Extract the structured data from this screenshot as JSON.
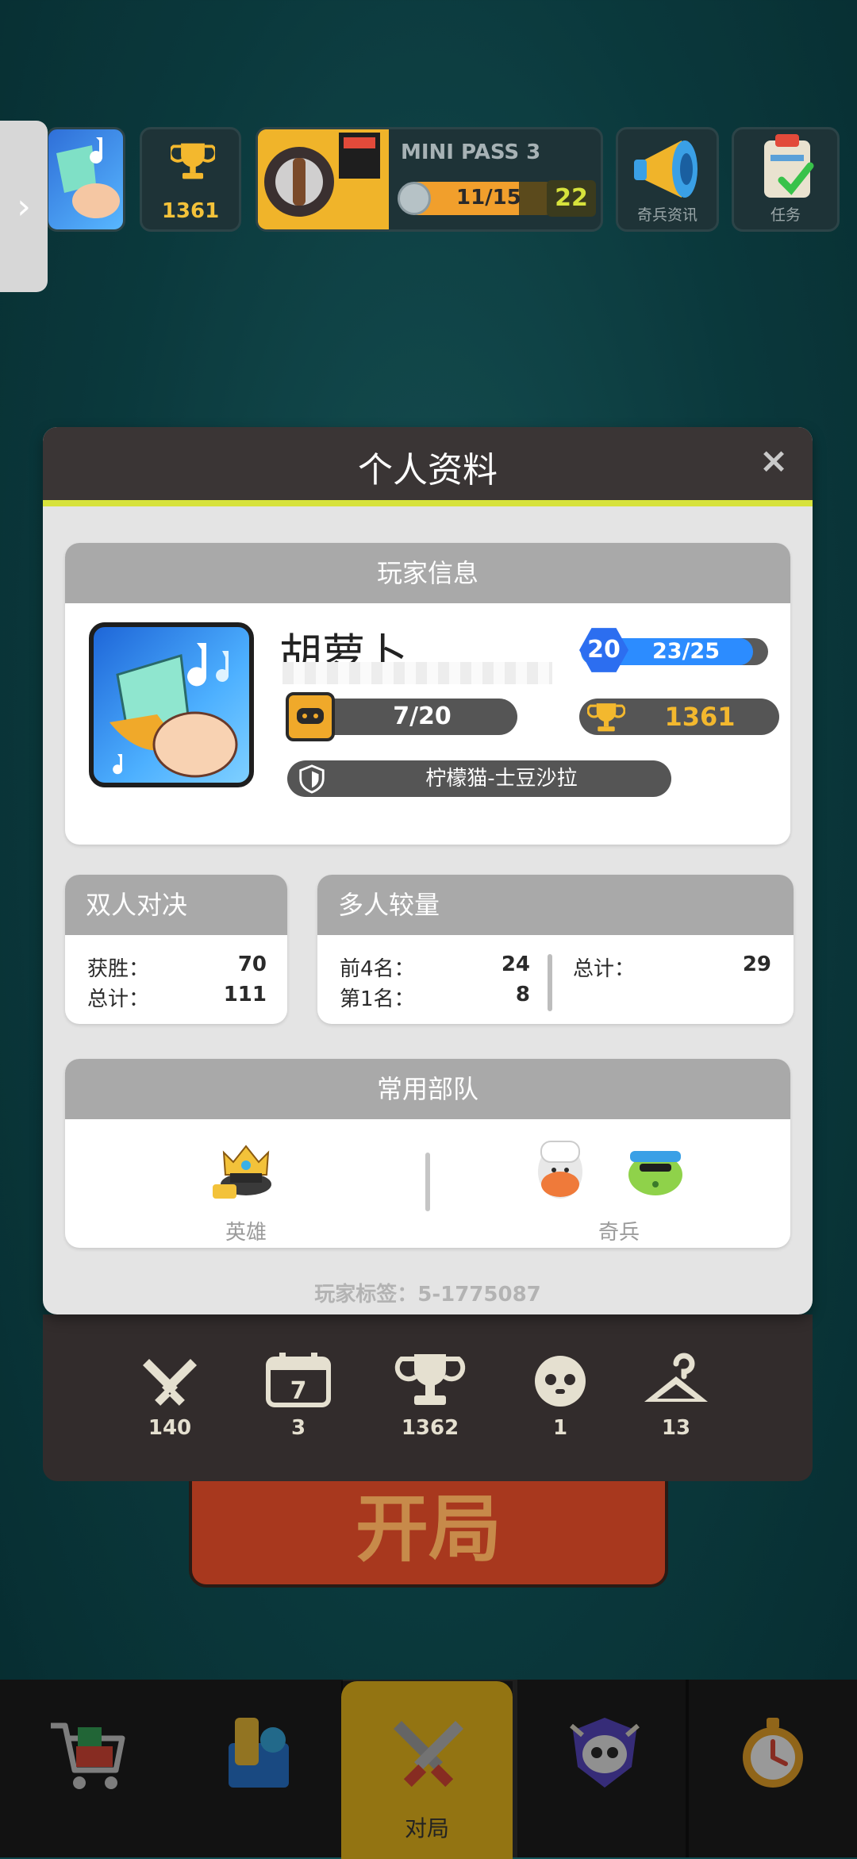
{
  "top_bar": {
    "trophy_count": "1361",
    "pass_title": "MINI PASS 3",
    "pass_progress": "11/15",
    "pass_progress_fraction": 0.733,
    "pass_level": "22",
    "news_label": "奇兵资讯",
    "tasks_label": "任务"
  },
  "modal": {
    "title": "个人资料",
    "close_symbol": "×",
    "player_info": {
      "header": "玩家信息",
      "name": "胡萝卜",
      "level": "20",
      "level_progress": "23/25",
      "level_progress_fraction": 0.92,
      "cards": "7/20",
      "trophies": "1361",
      "club": "柠檬猫-士豆沙拉"
    },
    "duel": {
      "header": "双人对决",
      "wins_label": "获胜：",
      "wins": "70",
      "total_label": "总计：",
      "total": "111"
    },
    "multiplayer": {
      "header": "多人较量",
      "top4_label": "前4名：",
      "top4": "24",
      "first_label": "第1名：",
      "first": "8",
      "total_label": "总计：",
      "total": "29"
    },
    "troops": {
      "header": "常用部队",
      "hero_label": "英雄",
      "troop_label": "奇兵"
    },
    "player_tag": "玩家标签：5-1775087"
  },
  "stats": [
    {
      "icon": "crossed-swords-icon",
      "value": "140"
    },
    {
      "icon": "calendar-icon",
      "value": "3"
    },
    {
      "icon": "trophy-icon",
      "value": "1362"
    },
    {
      "icon": "face-icon",
      "value": "1"
    },
    {
      "icon": "hanger-icon",
      "value": "13"
    }
  ],
  "calendar_day": "7",
  "start_button": "开局",
  "nav": {
    "battle_label": "对局"
  },
  "colors": {
    "accent_yellow": "#f5c21e",
    "level_blue": "#2c8cff",
    "trophy_gold": "#f3b82e",
    "header_gray": "#a9a9a9"
  }
}
